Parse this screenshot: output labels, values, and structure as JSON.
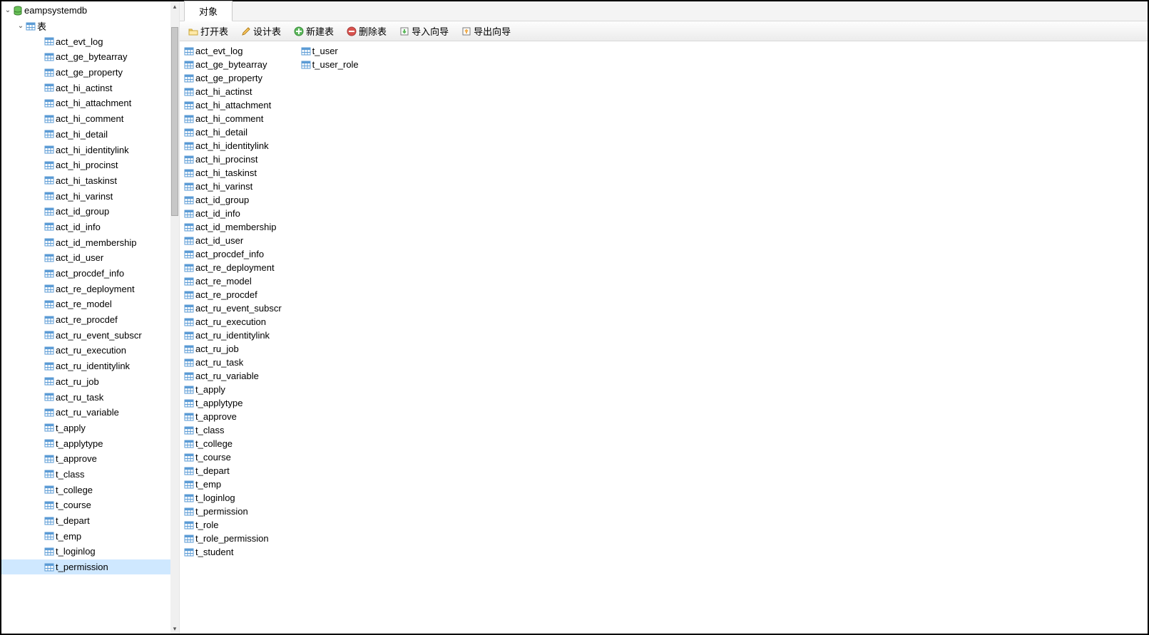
{
  "sidebar": {
    "db_name": "eampsystemdb",
    "tables_folder_label": "表",
    "selected": "t_permission",
    "tables": [
      "act_evt_log",
      "act_ge_bytearray",
      "act_ge_property",
      "act_hi_actinst",
      "act_hi_attachment",
      "act_hi_comment",
      "act_hi_detail",
      "act_hi_identitylink",
      "act_hi_procinst",
      "act_hi_taskinst",
      "act_hi_varinst",
      "act_id_group",
      "act_id_info",
      "act_id_membership",
      "act_id_user",
      "act_procdef_info",
      "act_re_deployment",
      "act_re_model",
      "act_re_procdef",
      "act_ru_event_subscr",
      "act_ru_execution",
      "act_ru_identitylink",
      "act_ru_job",
      "act_ru_task",
      "act_ru_variable",
      "t_apply",
      "t_applytype",
      "t_approve",
      "t_class",
      "t_college",
      "t_course",
      "t_depart",
      "t_emp",
      "t_loginlog",
      "t_permission"
    ]
  },
  "tabs": {
    "active": "对象"
  },
  "toolbar": {
    "open": "打开表",
    "design": "设计表",
    "new": "新建表",
    "delete": "删除表",
    "import": "导入向导",
    "export": "导出向导"
  },
  "objects": {
    "col1": [
      "act_evt_log",
      "act_ge_bytearray",
      "act_ge_property",
      "act_hi_actinst",
      "act_hi_attachment",
      "act_hi_comment",
      "act_hi_detail",
      "act_hi_identitylink",
      "act_hi_procinst",
      "act_hi_taskinst",
      "act_hi_varinst",
      "act_id_group",
      "act_id_info",
      "act_id_membership",
      "act_id_user",
      "act_procdef_info",
      "act_re_deployment",
      "act_re_model",
      "act_re_procdef",
      "act_ru_event_subscr",
      "act_ru_execution",
      "act_ru_identitylink",
      "act_ru_job",
      "act_ru_task",
      "act_ru_variable",
      "t_apply",
      "t_applytype",
      "t_approve",
      "t_class",
      "t_college",
      "t_course",
      "t_depart",
      "t_emp",
      "t_loginlog",
      "t_permission",
      "t_role",
      "t_role_permission",
      "t_student"
    ],
    "col2": [
      "t_user",
      "t_user_role"
    ]
  }
}
